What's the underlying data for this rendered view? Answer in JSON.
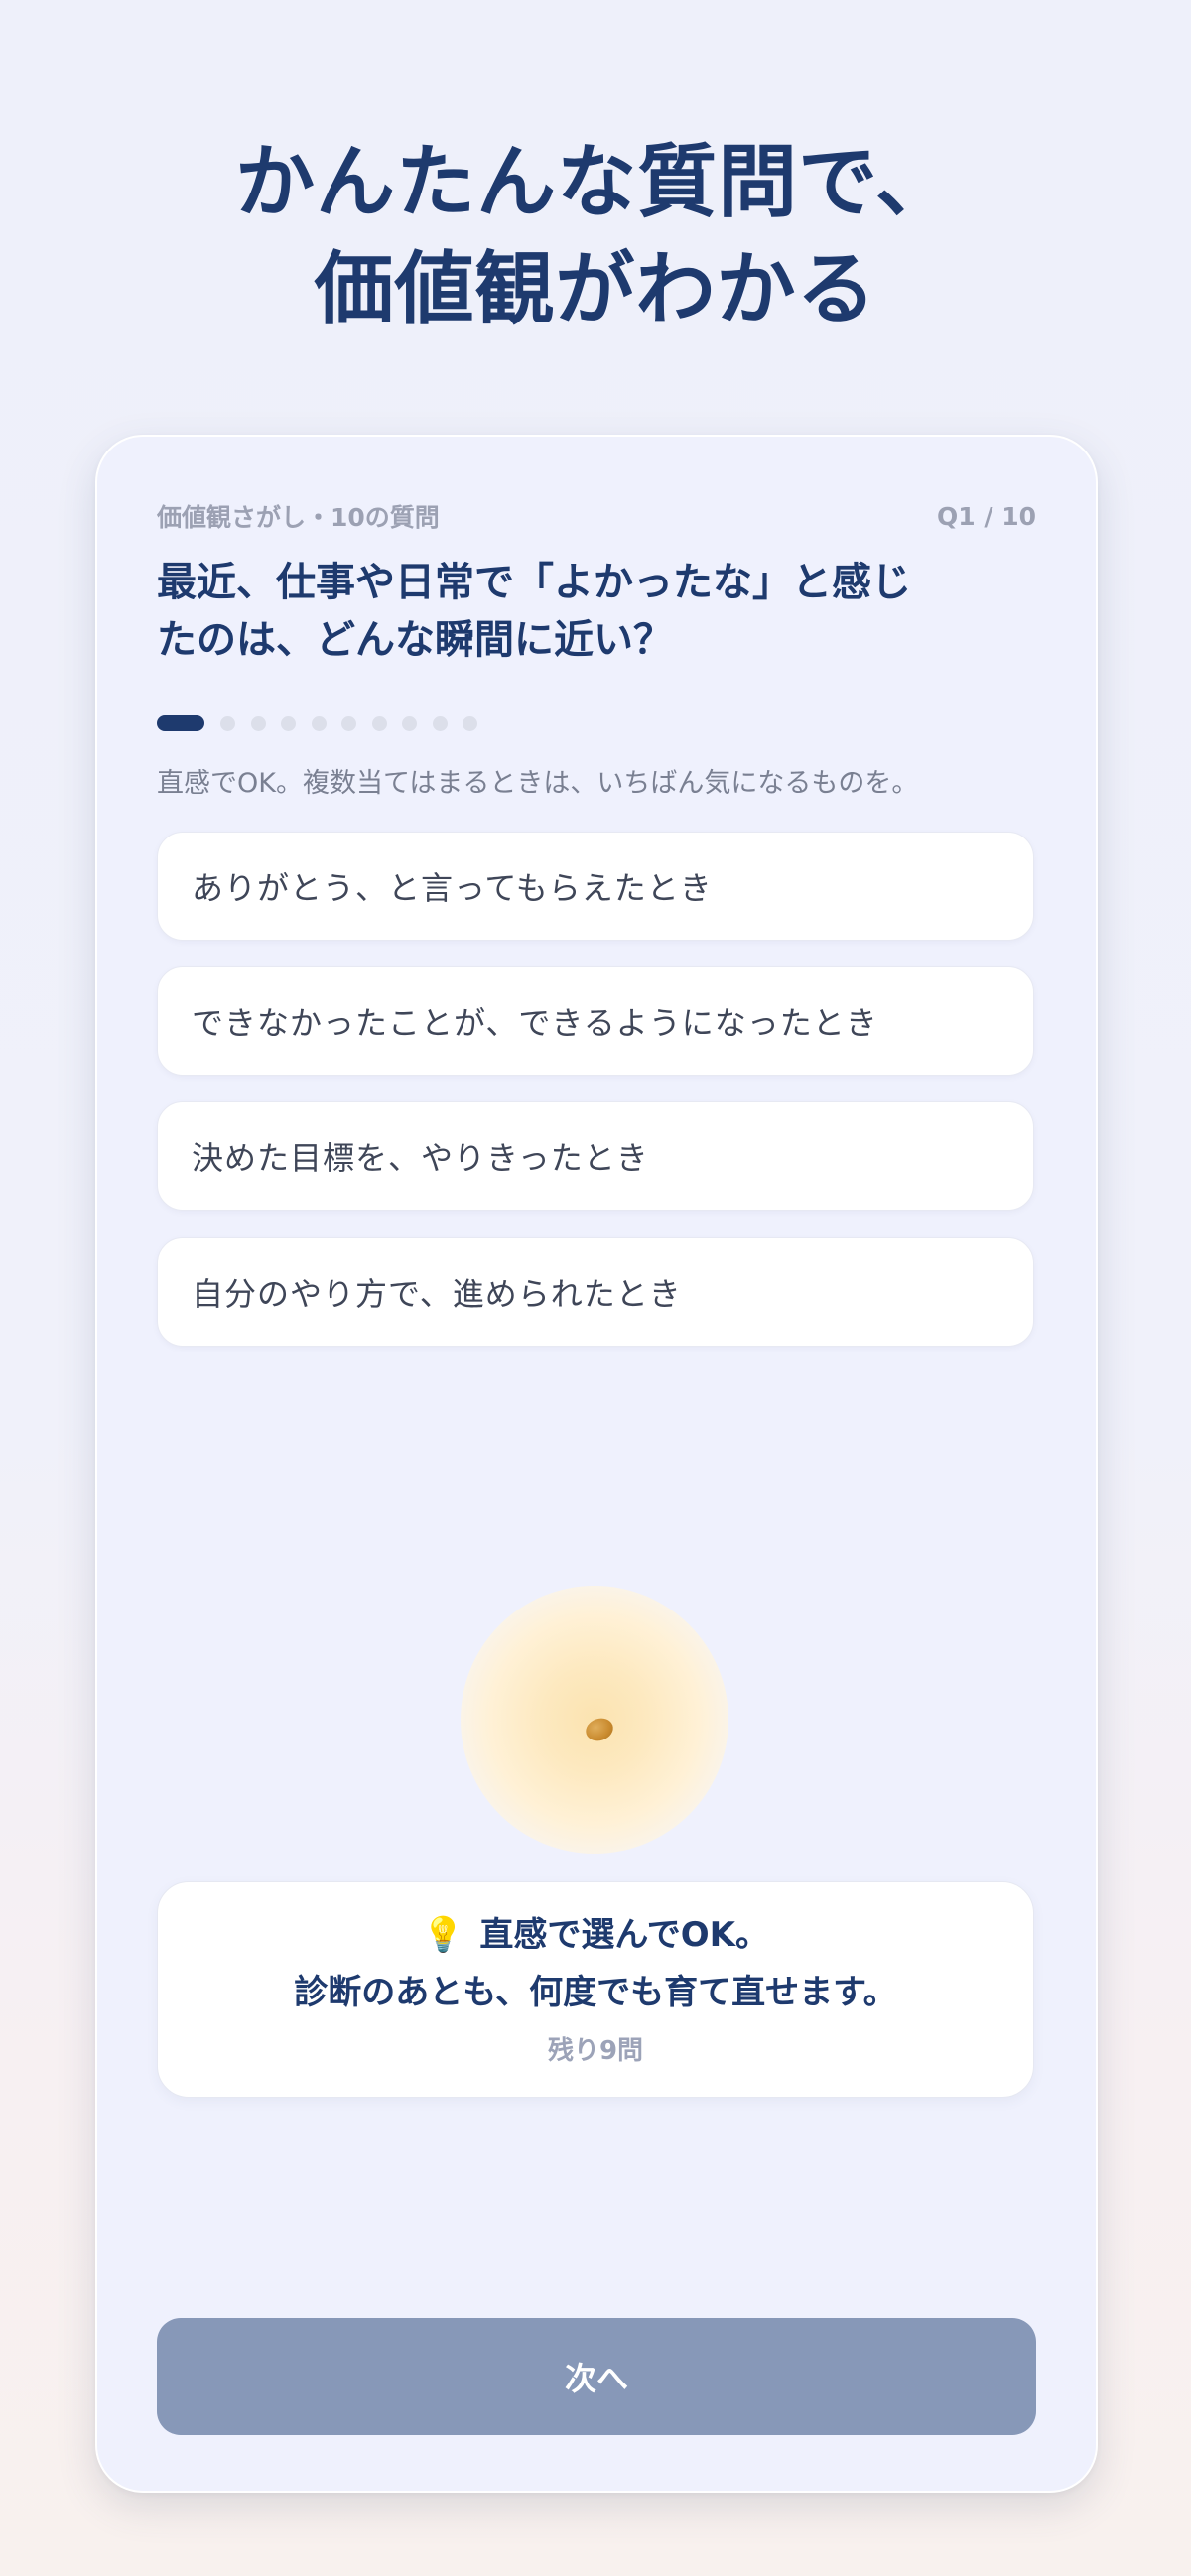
{
  "headline": {
    "line1": "かんたんな質問で、",
    "line2": "価値観がわかる"
  },
  "card": {
    "series_label": "価値観さがし・10の質問",
    "progress_label": "Q1 / 10",
    "question": {
      "line1": "最近、仕事や日常で「よかったな」と感じ",
      "line2": "たのは、どんな瞬間に近い？"
    },
    "progress": {
      "current": 1,
      "total": 10
    },
    "hint": "直感でOK。複数当てはまるときは、いちばん気になるものを。",
    "options": [
      {
        "label": "ありがとう、と言ってもらえたとき"
      },
      {
        "label": "できなかったことが、できるようになったとき"
      },
      {
        "label": "決めた目標を、やりきったとき"
      },
      {
        "label": "自分のやり方で、進められたとき"
      }
    ],
    "illustration": "seed-glow-illustration",
    "tip": {
      "icon": "💡",
      "line1": "直感で選んでOK。",
      "line2": "診断のあとも、何度でも育て直せます。",
      "remaining": "残り9問"
    },
    "next_label": "次へ"
  },
  "colors": {
    "primary": "#1e3a6e",
    "button_disabled": "#8798b8",
    "card_bg": "#eff1fd",
    "muted_text": "#9ca1b3"
  }
}
